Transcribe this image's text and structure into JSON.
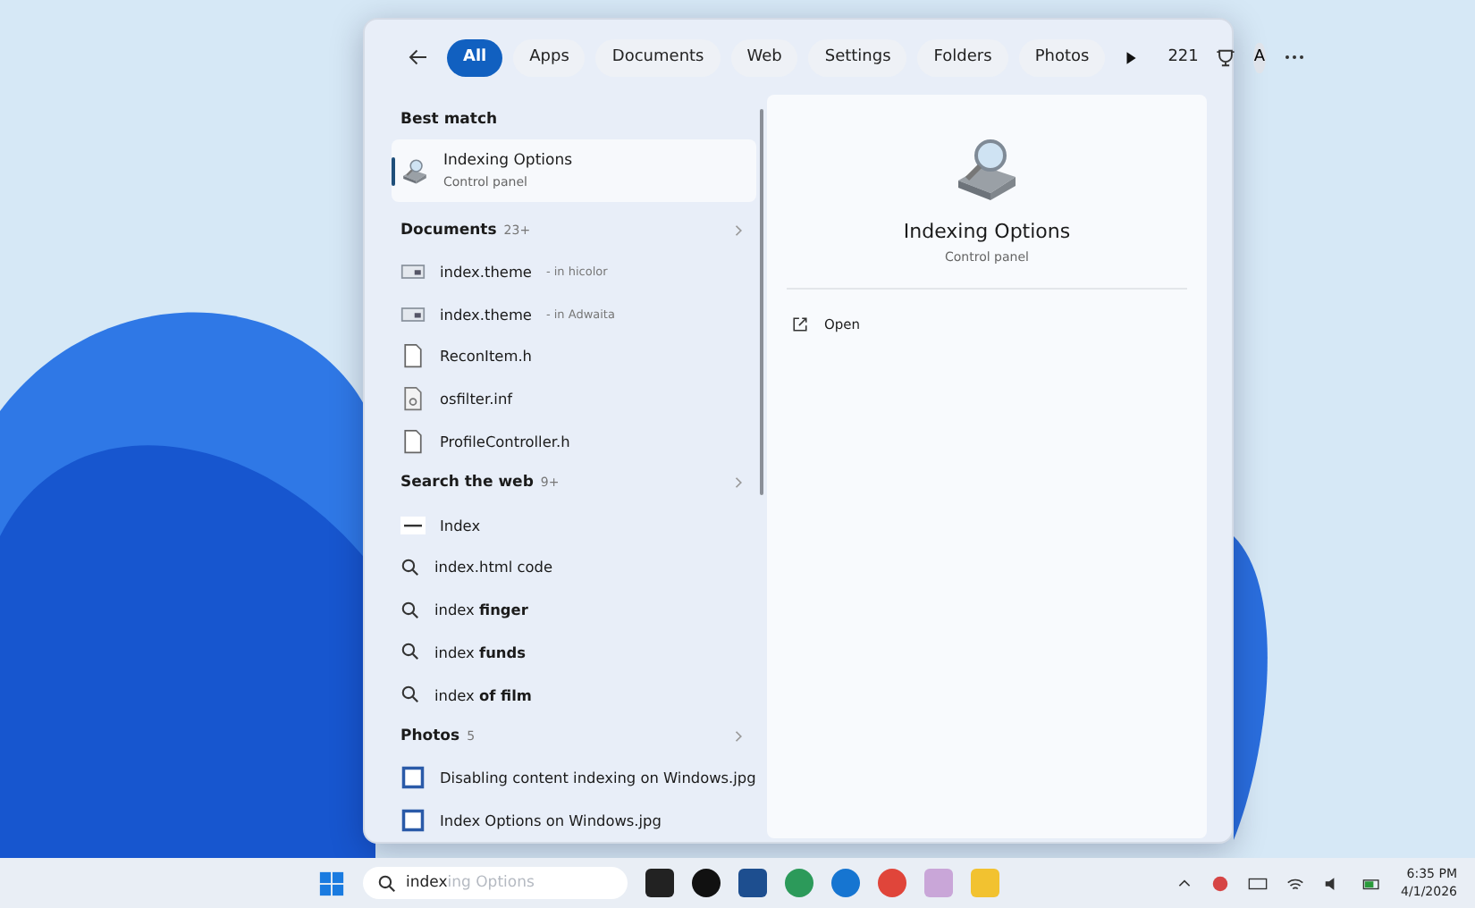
{
  "filters": [
    {
      "label": "All",
      "selected": true
    },
    {
      "label": "Apps",
      "selected": false
    },
    {
      "label": "Documents",
      "selected": false
    },
    {
      "label": "Web",
      "selected": false
    },
    {
      "label": "Settings",
      "selected": false
    },
    {
      "label": "Folders",
      "selected": false
    },
    {
      "label": "Photos",
      "selected": false
    }
  ],
  "points": "221",
  "account_initial": "A",
  "sections": [
    {
      "title": "Best match",
      "items": [
        {
          "kind": "best",
          "name": "Indexing Options",
          "subtitle": "Control panel",
          "selected": true
        }
      ]
    },
    {
      "title": "Documents",
      "count": "23+",
      "items": [
        {
          "kind": "theme",
          "name": "index.theme",
          "location": "- in hicolor"
        },
        {
          "kind": "theme",
          "name": "index.theme",
          "location": "- in Adwaita"
        },
        {
          "kind": "file",
          "name": "ReconItem.h"
        },
        {
          "kind": "inf",
          "name": "osfilter.inf"
        },
        {
          "kind": "file",
          "name": "ProfileController.h"
        }
      ]
    },
    {
      "title": "Search the web",
      "count": "9+",
      "items": [
        {
          "kind": "web",
          "name": "Index"
        },
        {
          "kind": "search",
          "name": "index.html code"
        },
        {
          "kind": "search",
          "name": "index **finger**"
        },
        {
          "kind": "search",
          "name": "index **funds**"
        },
        {
          "kind": "search",
          "name": "index **of film**"
        }
      ]
    },
    {
      "title": "Photos",
      "count": "5",
      "items": [
        {
          "kind": "photo",
          "name": "Disabling content indexing on Windows.jpg"
        },
        {
          "kind": "photo",
          "name": "Index Options on Windows.jpg"
        }
      ]
    }
  ],
  "preview": {
    "title": "Indexing Options",
    "subtitle": "Control panel",
    "actions": [
      "Open"
    ]
  },
  "taskbar": {
    "search_value": "index",
    "search_suggestion": "ing Options",
    "time": "6:35 PM",
    "date": "4/1/2026"
  }
}
